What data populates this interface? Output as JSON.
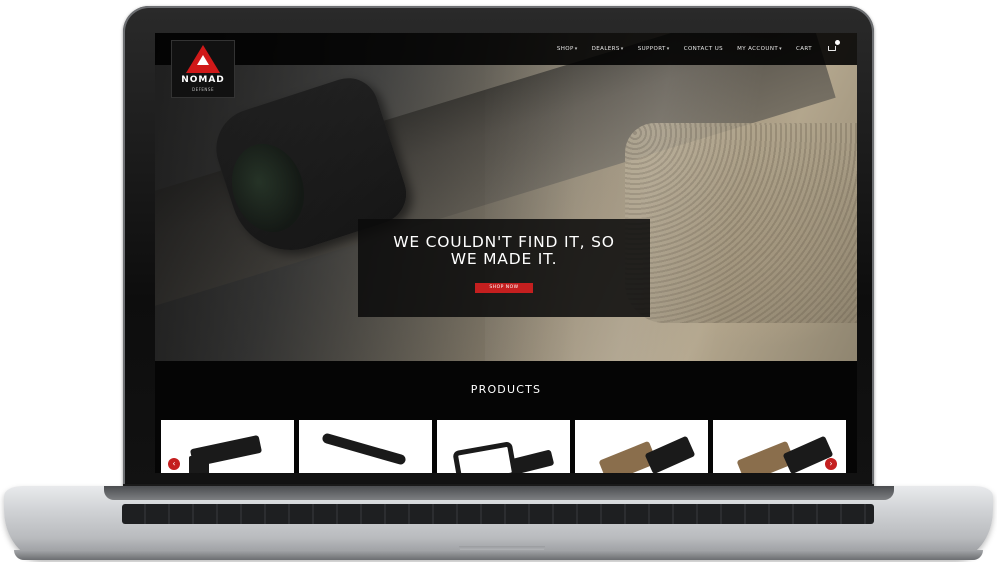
{
  "nav": {
    "logo_text": "NOMAD",
    "logo_subtext": "DEFENSE",
    "items": [
      {
        "label": "SHOP",
        "has_dropdown": true
      },
      {
        "label": "DEALERS",
        "has_dropdown": true
      },
      {
        "label": "SUPPORT",
        "has_dropdown": true
      },
      {
        "label": "CONTACT US",
        "has_dropdown": false
      },
      {
        "label": "MY ACCOUNT",
        "has_dropdown": true
      },
      {
        "label": "CART",
        "has_dropdown": false
      }
    ],
    "cart_icon": "cart-icon",
    "caret": "▾"
  },
  "hero": {
    "title_line1": "WE COULDN'T FIND IT, SO",
    "title_line2": "WE MADE IT.",
    "button_label": "SHOP NOW"
  },
  "products": {
    "title": "PRODUCTS",
    "cards": [
      {
        "name": "product-1",
        "tone": "black"
      },
      {
        "name": "product-2",
        "tone": "black"
      },
      {
        "name": "product-3",
        "tone": "black"
      },
      {
        "name": "product-4",
        "tone": "tan"
      },
      {
        "name": "product-5",
        "tone": "tan"
      }
    ],
    "prev_arrow": "‹",
    "next_arrow": "›"
  },
  "colors": {
    "accent": "#c41f1f",
    "nav_bg": "#000000",
    "text": "#ffffff"
  }
}
